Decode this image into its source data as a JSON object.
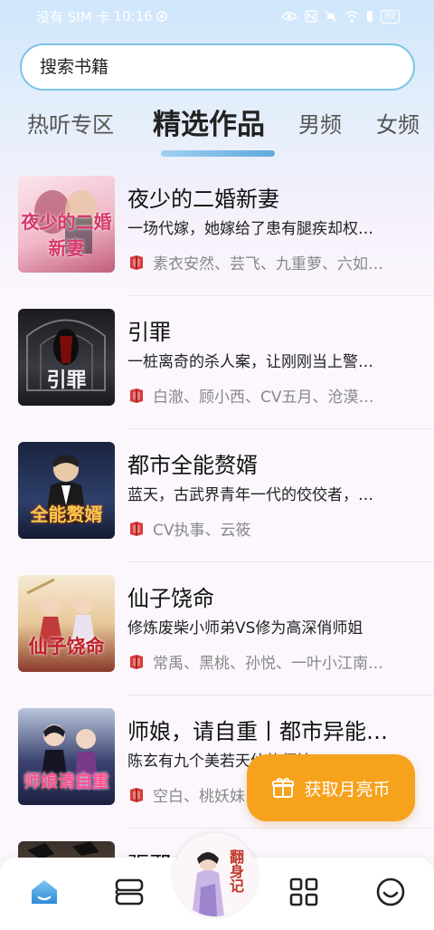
{
  "status_bar": {
    "carrier": "没有 SIM 卡",
    "time": "10:16",
    "battery": "92"
  },
  "search": {
    "placeholder": "搜索书籍"
  },
  "tabs": [
    {
      "label": "热听专区",
      "active": false
    },
    {
      "label": "精选作品",
      "active": true
    },
    {
      "label": "男频",
      "active": false
    },
    {
      "label": "女频",
      "active": false
    }
  ],
  "books": [
    {
      "title": "夜少的二婚新妻",
      "description": "一场代嫁，她嫁给了患有腿疾却权…",
      "authors": "素衣安然、芸飞、九重萝、六如…",
      "cover_text": "夜少的二婚新妻",
      "cover_colors": [
        "#f7d6e3",
        "#c25d7a"
      ]
    },
    {
      "title": "引罪",
      "description": "一桩离奇的杀人案，让刚刚当上警…",
      "authors": "白澈、顾小西、CV五月、沧漠…",
      "cover_text": "引罪",
      "cover_colors": [
        "#2a2a2e",
        "#6b1010"
      ]
    },
    {
      "title": "都市全能赘婿",
      "description": "蓝天，古武界青年一代的佼佼者，…",
      "authors": "CV执事、云筱",
      "cover_text": "全能赘婿",
      "cover_colors": [
        "#1d2b4a",
        "#c8a23c"
      ]
    },
    {
      "title": "仙子饶命",
      "description": "修炼废柴小师弟VS修为高深俏师姐",
      "authors": "常禹、黑桃、孙悦、一叶小江南…",
      "cover_text": "仙子饶命",
      "cover_colors": [
        "#f3e0c0",
        "#c0202a"
      ]
    },
    {
      "title": "师娘，请自重丨都市异能…",
      "description": "陈玄有九个美若天仙的师娘，三…",
      "authors": "空白、桃妖妹…",
      "cover_text": "师娘请自重",
      "cover_colors": [
        "#2b2f55",
        "#d44a8a"
      ]
    },
    {
      "title": "驱邪…",
      "description": "",
      "authors": "",
      "cover_text": "",
      "cover_colors": [
        "#3a2f2a",
        "#d9c7a8"
      ]
    }
  ],
  "cta": {
    "label": "获取月亮币"
  },
  "center_disc": {
    "text": "翻身记"
  },
  "colors": {
    "accent_blue": "#5fa9de",
    "cta_orange": "#f7a21c",
    "author_icon_red": "#d83a3a"
  }
}
